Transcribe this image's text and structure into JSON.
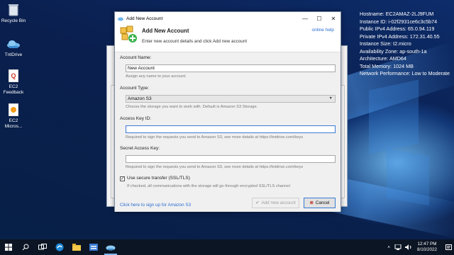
{
  "desktop": {
    "icons": [
      {
        "label": "Recycle Bin",
        "icon": "recycle-bin-icon"
      },
      {
        "label": "TntDrive",
        "icon": "cloud-drive-icon"
      },
      {
        "label": "EC2 Feedback",
        "icon": "feedback-icon"
      },
      {
        "label": "EC2 Micros...",
        "icon": "ec2-icon"
      }
    ],
    "sysinfo": [
      "Hostname: EC2AMAZ-2LJ9FUM",
      "Instance ID: i-02f2931ce6c3c5b74",
      "Public IPv4 Address: 65.0.94.119",
      "Private IPv4 Address: 172.31.40.55",
      "Instance Size: t2.micro",
      "Availability Zone: ap-south-1a",
      "Architecture: AMD64",
      "Total Memory: 1024 MB",
      "Network Performance: Low to Moderate"
    ]
  },
  "dialog": {
    "title": "Add New Account",
    "header_title": "Add New Account",
    "header_subtitle": "Enter new account details and click Add new account",
    "help_link": "online help",
    "account_name": {
      "label": "Account Name:",
      "value": "New Account",
      "hint": "Assign any name to your account."
    },
    "account_type": {
      "label": "Account Type:",
      "value": "Amazon S3",
      "hint": "Choose the storage you want to work with. Default is Amazon S3 Storage."
    },
    "access_key": {
      "label": "Access Key ID:",
      "value": "",
      "hint": "Required to sign the requests you send to Amazon S3, see more details at https://tntdrive.com/keys"
    },
    "secret_key": {
      "label": "Secret Access Key:",
      "value": "",
      "hint": "Required to sign the requests you send to Amazon S3, see more details at https://tntdrive.com/keys"
    },
    "secure": {
      "label": "Use secure transfer (SSL/TLS)",
      "checked": true,
      "hint": "If checked, all communications with the storage will go through encrypted SSL/TLS channel"
    },
    "signup_link": "Click here to sign up for Amazon S3",
    "add_button": "Add new account",
    "cancel_button": "Cancel"
  },
  "taskbar": {
    "time": "12:47 PM",
    "date": "8/10/2022"
  },
  "colors": {
    "accent": "#2a6dd0",
    "taskbar": "#0c1524"
  }
}
